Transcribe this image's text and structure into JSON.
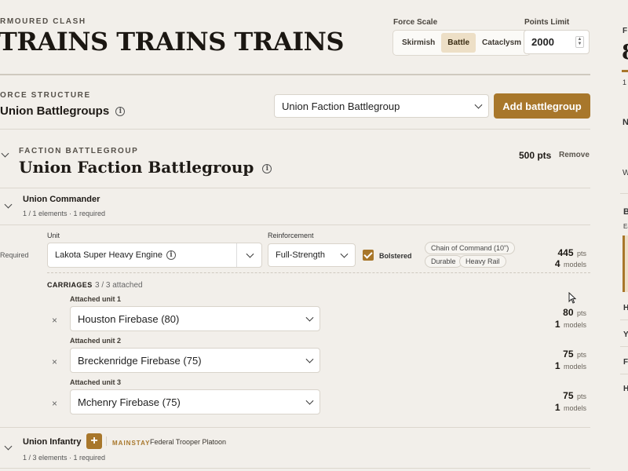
{
  "header": {
    "kicker": "RMOURED CLASH",
    "title": "TRAINS TRAINS TRAINS",
    "force_scale_label": "Force Scale",
    "force_scale_options": [
      "Skirmish",
      "Battle",
      "Cataclysm"
    ],
    "force_scale_selected": "Battle",
    "points_limit_label": "Points Limit",
    "points_limit_value": "2000"
  },
  "force_structure": {
    "kicker": "ORCE STRUCTURE",
    "title": "Union Battlegroups",
    "select_value": "Union Faction Battlegroup",
    "add_button": "Add battlegroup"
  },
  "battlegroup": {
    "kicker": "FACTION BATTLEGROUP",
    "title": "Union Faction Battlegroup",
    "points": "500 pts",
    "remove": "Remove"
  },
  "commander": {
    "title": "Union Commander",
    "subtitle": "1 / 1 elements · 1 required",
    "required_label": "Required",
    "unit_label": "Unit",
    "unit_value": "Lakota Super Heavy Engine",
    "reinforcement_label": "Reinforcement",
    "reinforcement_value": "Full-Strength",
    "bolstered_label": "Bolstered",
    "tags": [
      "Chain of Command (10\")",
      "Durable",
      "Heavy Rail"
    ],
    "points": "445",
    "points_unit": "pts",
    "models": "4",
    "models_unit": "models"
  },
  "carriages": {
    "title": "CARRIAGES",
    "count": "3 / 3 attached",
    "items": [
      {
        "label": "Attached unit 1",
        "value": "Houston Firebase (80)",
        "points": "80",
        "points_unit": "pts",
        "models": "1",
        "models_unit": "models"
      },
      {
        "label": "Attached unit 2",
        "value": "Breckenridge Firebase (75)",
        "points": "75",
        "points_unit": "pts",
        "models": "1",
        "models_unit": "models"
      },
      {
        "label": "Attached unit 3",
        "value": "Mchenry Firebase (75)",
        "points": "75",
        "points_unit": "pts",
        "models": "1",
        "models_unit": "models"
      }
    ]
  },
  "infantry": {
    "title": "Union Infantry",
    "add_symbol": "+",
    "badge": "MAINSTAY",
    "detail": "Federal Trooper Platoon",
    "subtitle": "1 / 3 elements · 1 required"
  },
  "sidebar_fragments": [
    "F",
    "8",
    "1",
    "N",
    "W",
    "B",
    "Ea",
    "H",
    "Y",
    "F",
    "H"
  ]
}
